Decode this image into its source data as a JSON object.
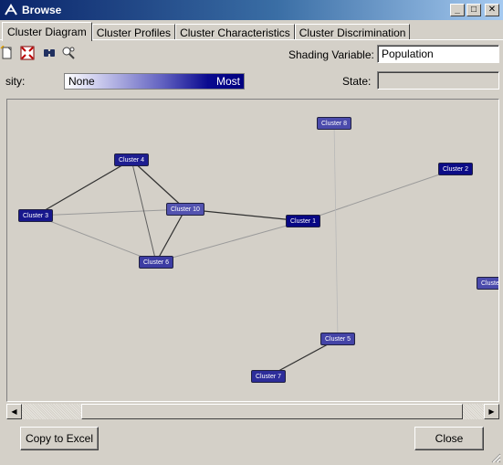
{
  "window": {
    "title": "Browse",
    "minimize": "_",
    "maximize": "□",
    "close": "✕"
  },
  "tabs": [
    {
      "label": "Cluster Diagram",
      "active": true
    },
    {
      "label": "Cluster Profiles",
      "active": false
    },
    {
      "label": "Cluster Characteristics",
      "active": false
    },
    {
      "label": "Cluster Discrimination",
      "active": false
    }
  ],
  "toolbar": {
    "icons": [
      "new-document-icon",
      "fit-to-window-icon",
      "find-node-icon",
      "zoom-icon"
    ]
  },
  "shading": {
    "label": "Shading Variable:",
    "value": "Population"
  },
  "density": {
    "label": "sity:",
    "none_label": "None",
    "most_label": "Most"
  },
  "state": {
    "label": "State:",
    "value": ""
  },
  "diagram": {
    "nodes": [
      {
        "id": "c1",
        "label": "Cluster 1",
        "shade": 0.95
      },
      {
        "id": "c2",
        "label": "Cluster 2",
        "shade": 0.92
      },
      {
        "id": "c3",
        "label": "Cluster 3",
        "shade": 0.85
      },
      {
        "id": "c4",
        "label": "Cluster 4",
        "shade": 0.8
      },
      {
        "id": "c5",
        "label": "Cluster 5",
        "shade": 0.55
      },
      {
        "id": "c6",
        "label": "Cluster 6",
        "shade": 0.6
      },
      {
        "id": "c7",
        "label": "Cluster 7",
        "shade": 0.7
      },
      {
        "id": "c8",
        "label": "Cluster 8",
        "shade": 0.5
      },
      {
        "id": "c9",
        "label": "Cluste",
        "shade": 0.5
      },
      {
        "id": "c10",
        "label": "Cluster 10",
        "shade": 0.45
      }
    ],
    "edges": [
      {
        "from": "c3",
        "to": "c4",
        "strength": "strong"
      },
      {
        "from": "c3",
        "to": "c10",
        "strength": "weak"
      },
      {
        "from": "c3",
        "to": "c6",
        "strength": "weak"
      },
      {
        "from": "c4",
        "to": "c10",
        "strength": "strong"
      },
      {
        "from": "c4",
        "to": "c6",
        "strength": "medium"
      },
      {
        "from": "c10",
        "to": "c6",
        "strength": "strong"
      },
      {
        "from": "c10",
        "to": "c1",
        "strength": "strong"
      },
      {
        "from": "c6",
        "to": "c1",
        "strength": "weak"
      },
      {
        "from": "c1",
        "to": "c2",
        "strength": "weak"
      },
      {
        "from": "c8",
        "to": "c5",
        "strength": "faint"
      },
      {
        "from": "c5",
        "to": "c7",
        "strength": "strong"
      }
    ]
  },
  "buttons": {
    "copy_to_excel": "Copy to Excel",
    "close": "Close"
  },
  "colors": {
    "title_start": "#0a246a",
    "title_end": "#a6caf0",
    "node_dark": "#000080",
    "node_light": "#8888cc"
  }
}
